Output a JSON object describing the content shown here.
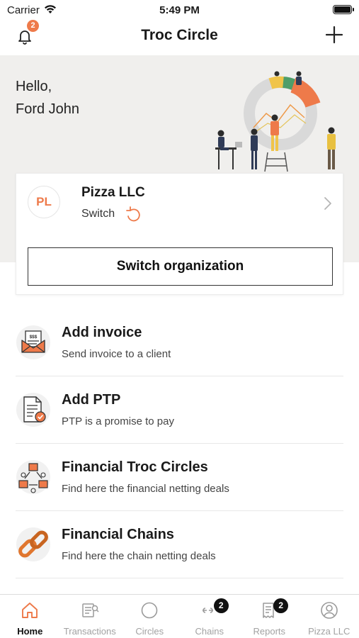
{
  "status_bar": {
    "carrier": "Carrier",
    "time": "5:49 PM",
    "battery_level": 1.0
  },
  "header": {
    "title": "Troc Circle",
    "notifications_badge": "2"
  },
  "hero": {
    "greeting_line1": "Hello,",
    "greeting_line2": "Ford John"
  },
  "org_card": {
    "initials": "PL",
    "name": "Pizza LLC",
    "switch_label": "Switch",
    "button_label": "Switch organization"
  },
  "actions": [
    {
      "title": "Add invoice",
      "subtitle": "Send invoice to a client",
      "icon": "invoice-envelope-icon"
    },
    {
      "title": "Add PTP",
      "subtitle": "PTP is a promise to pay",
      "icon": "ptp-document-icon"
    },
    {
      "title": "Financial Troc Circles",
      "subtitle": "Find here the financial netting deals",
      "icon": "troc-circles-icon"
    },
    {
      "title": "Financial Chains",
      "subtitle": "Find here the chain netting deals",
      "icon": "chain-links-icon"
    }
  ],
  "tabs": [
    {
      "label": "Home",
      "active": true
    },
    {
      "label": "Transactions"
    },
    {
      "label": "Circles"
    },
    {
      "label": "Chains",
      "badge": "2"
    },
    {
      "label": "Reports",
      "badge": "2"
    },
    {
      "label": "Pizza LLC"
    }
  ],
  "colors": {
    "accent": "#ee7a4a",
    "hero_bg": "#f0efed"
  }
}
